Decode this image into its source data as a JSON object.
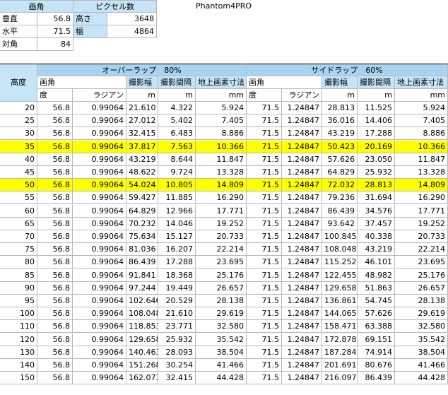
{
  "title": "Phantom4PRO",
  "fov_box": {
    "header": "画角",
    "rows": [
      {
        "label": "垂直",
        "value": "56.8"
      },
      {
        "label": "水平",
        "value": "71.5"
      },
      {
        "label": "対角",
        "value": "84"
      }
    ]
  },
  "pixel_box": {
    "header": "ピクセル数",
    "rows": [
      {
        "label": "高さ",
        "value": "3648"
      },
      {
        "label": "幅",
        "value": "4864"
      }
    ]
  },
  "main_table": {
    "altitude_header": "高度",
    "overlap_header": "オーバーラップ　80%",
    "sidelap_header": "サイドラップ　60%",
    "sub_headers": {
      "fov": "画角",
      "width": "撮影幅",
      "interval": "撮影間隔",
      "gsd": "地上画素寸法"
    },
    "units": {
      "degree": "度",
      "radian": "ラジアン",
      "m": "m",
      "mm": "mm"
    },
    "rows": [
      {
        "alt": "20",
        "d1": "56.8",
        "r1": "0.99064",
        "w1": "21.610",
        "i1": "4.322",
        "g1": "5.924",
        "d2": "71.5",
        "r2": "1.24847",
        "w2": "28.813",
        "i2": "11.525",
        "g2": "5.924",
        "hl": false
      },
      {
        "alt": "25",
        "d1": "56.8",
        "r1": "0.99064",
        "w1": "27.012",
        "i1": "5.402",
        "g1": "7.405",
        "d2": "71.5",
        "r2": "1.24847",
        "w2": "36.016",
        "i2": "14.406",
        "g2": "7.405",
        "hl": false
      },
      {
        "alt": "30",
        "d1": "56.8",
        "r1": "0.99064",
        "w1": "32.415",
        "i1": "6.483",
        "g1": "8.886",
        "d2": "71.5",
        "r2": "1.24847",
        "w2": "43.219",
        "i2": "17.288",
        "g2": "8.886",
        "hl": false
      },
      {
        "alt": "35",
        "d1": "56.8",
        "r1": "0.99064",
        "w1": "37.817",
        "i1": "7.563",
        "g1": "10.366",
        "d2": "71.5",
        "r2": "1.24847",
        "w2": "50.423",
        "i2": "20.169",
        "g2": "10.366",
        "hl": true
      },
      {
        "alt": "40",
        "d1": "56.8",
        "r1": "0.99064",
        "w1": "43.219",
        "i1": "8.644",
        "g1": "11.847",
        "d2": "71.5",
        "r2": "1.24847",
        "w2": "57.626",
        "i2": "23.050",
        "g2": "11.847",
        "hl": false
      },
      {
        "alt": "45",
        "d1": "56.8",
        "r1": "0.99064",
        "w1": "48.622",
        "i1": "9.724",
        "g1": "13.328",
        "d2": "71.5",
        "r2": "1.24847",
        "w2": "64.829",
        "i2": "25.932",
        "g2": "13.328",
        "hl": false
      },
      {
        "alt": "50",
        "d1": "56.8",
        "r1": "0.99064",
        "w1": "54.024",
        "i1": "10.805",
        "g1": "14.809",
        "d2": "71.5",
        "r2": "1.24847",
        "w2": "72.032",
        "i2": "28.813",
        "g2": "14.809",
        "hl": true
      },
      {
        "alt": "55",
        "d1": "56.8",
        "r1": "0.99064",
        "w1": "59.427",
        "i1": "11.885",
        "g1": "16.290",
        "d2": "71.5",
        "r2": "1.24847",
        "w2": "79.236",
        "i2": "31.694",
        "g2": "16.290",
        "hl": false
      },
      {
        "alt": "60",
        "d1": "56.8",
        "r1": "0.99064",
        "w1": "64.829",
        "i1": "12.966",
        "g1": "17.771",
        "d2": "71.5",
        "r2": "1.24847",
        "w2": "86.439",
        "i2": "34.576",
        "g2": "17.771",
        "hl": false
      },
      {
        "alt": "65",
        "d1": "56.8",
        "r1": "0.99064",
        "w1": "70.232",
        "i1": "14.046",
        "g1": "19.252",
        "d2": "71.5",
        "r2": "1.24847",
        "w2": "93.642",
        "i2": "37.457",
        "g2": "19.252",
        "hl": false
      },
      {
        "alt": "70",
        "d1": "56.8",
        "r1": "0.99064",
        "w1": "75.634",
        "i1": "15.127",
        "g1": "20.733",
        "d2": "71.5",
        "r2": "1.24847",
        "w2": "100.845",
        "i2": "40.338",
        "g2": "20.733",
        "hl": false
      },
      {
        "alt": "75",
        "d1": "56.8",
        "r1": "0.99064",
        "w1": "81.036",
        "i1": "16.207",
        "g1": "22.214",
        "d2": "71.5",
        "r2": "1.24847",
        "w2": "108.048",
        "i2": "43.219",
        "g2": "22.214",
        "hl": false
      },
      {
        "alt": "80",
        "d1": "56.8",
        "r1": "0.99064",
        "w1": "86.439",
        "i1": "17.288",
        "g1": "23.695",
        "d2": "71.5",
        "r2": "1.24847",
        "w2": "115.252",
        "i2": "46.101",
        "g2": "23.695",
        "hl": false
      },
      {
        "alt": "85",
        "d1": "56.8",
        "r1": "0.99064",
        "w1": "91.841",
        "i1": "18.368",
        "g1": "25.176",
        "d2": "71.5",
        "r2": "1.24847",
        "w2": "122.455",
        "i2": "48.982",
        "g2": "25.176",
        "hl": false
      },
      {
        "alt": "90",
        "d1": "56.8",
        "r1": "0.99064",
        "w1": "97.244",
        "i1": "19.449",
        "g1": "26.657",
        "d2": "71.5",
        "r2": "1.24847",
        "w2": "129.658",
        "i2": "51.863",
        "g2": "26.657",
        "hl": false
      },
      {
        "alt": "95",
        "d1": "56.8",
        "r1": "0.99064",
        "w1": "102.646",
        "i1": "20.529",
        "g1": "28.138",
        "d2": "71.5",
        "r2": "1.24847",
        "w2": "136.861",
        "i2": "54.745",
        "g2": "28.138",
        "hl": false
      },
      {
        "alt": "100",
        "d1": "56.8",
        "r1": "0.99064",
        "w1": "108.048",
        "i1": "21.610",
        "g1": "29.619",
        "d2": "71.5",
        "r2": "1.24847",
        "w2": "144.065",
        "i2": "57.626",
        "g2": "29.619",
        "hl": false
      },
      {
        "alt": "110",
        "d1": "56.8",
        "r1": "0.99064",
        "w1": "118.853",
        "i1": "23.771",
        "g1": "32.580",
        "d2": "71.5",
        "r2": "1.24847",
        "w2": "158.471",
        "i2": "63.388",
        "g2": "32.580",
        "hl": false
      },
      {
        "alt": "120",
        "d1": "56.8",
        "r1": "0.99064",
        "w1": "129.658",
        "i1": "25.932",
        "g1": "35.542",
        "d2": "71.5",
        "r2": "1.24847",
        "w2": "172.878",
        "i2": "69.151",
        "g2": "35.542",
        "hl": false
      },
      {
        "alt": "130",
        "d1": "56.8",
        "r1": "0.99064",
        "w1": "140.463",
        "i1": "28.093",
        "g1": "38.504",
        "d2": "71.5",
        "r2": "1.24847",
        "w2": "187.284",
        "i2": "74.914",
        "g2": "38.504",
        "hl": false
      },
      {
        "alt": "140",
        "d1": "56.8",
        "r1": "0.99064",
        "w1": "151.268",
        "i1": "30.254",
        "g1": "41.466",
        "d2": "71.5",
        "r2": "1.24847",
        "w2": "201.691",
        "i2": "80.676",
        "g2": "41.466",
        "hl": false
      },
      {
        "alt": "150",
        "d1": "56.8",
        "r1": "0.99064",
        "w1": "162.073",
        "i1": "32.415",
        "g1": "44.428",
        "d2": "71.5",
        "r2": "1.24847",
        "w2": "216.097",
        "i2": "86.439",
        "g2": "44.428",
        "hl": false
      }
    ]
  },
  "colors": {
    "header_light": "#c5e4f7",
    "header_dark": "#a8d4f2",
    "highlight": "#ffff00"
  }
}
